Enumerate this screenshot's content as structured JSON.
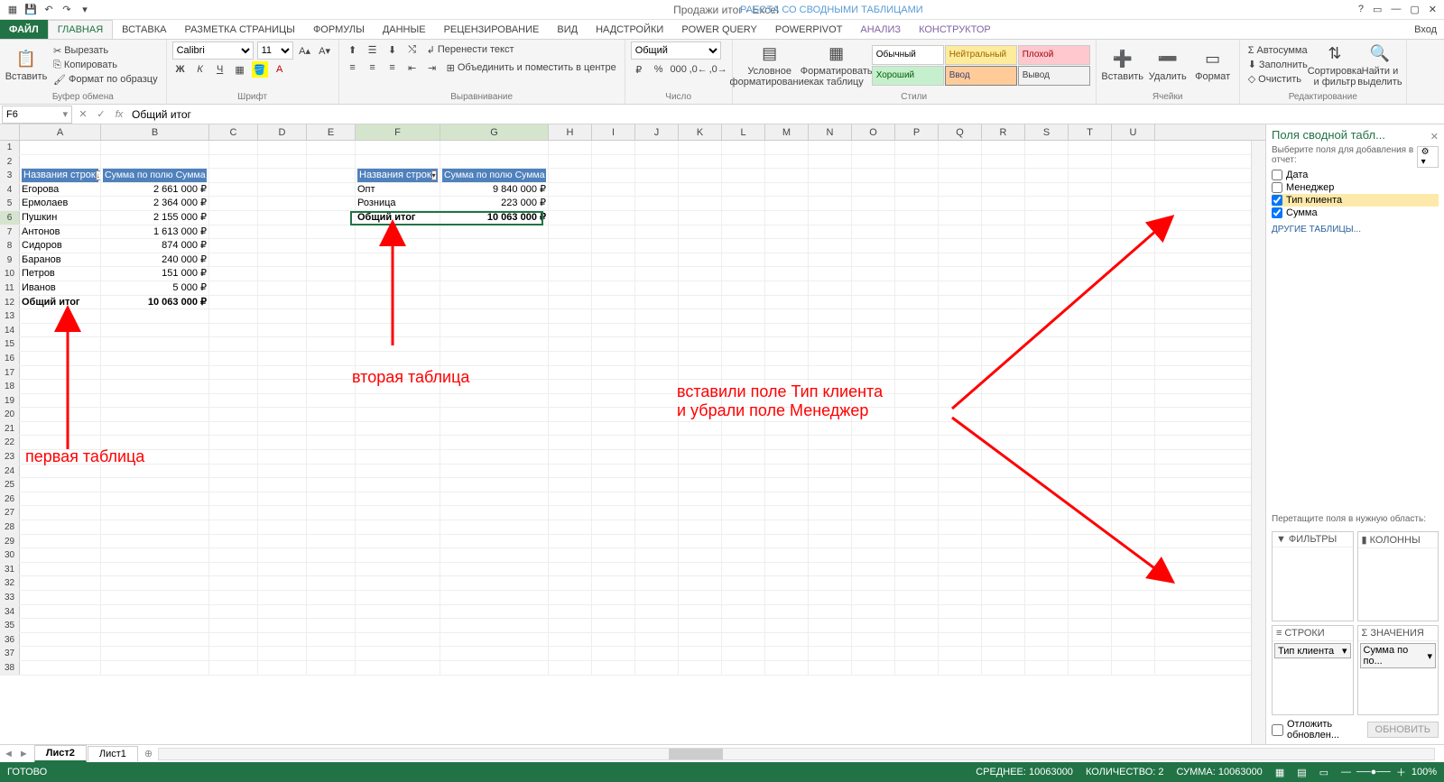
{
  "qat": {
    "title": "Продажи итог - Excel",
    "context": "РАБОТА СО СВОДНЫМИ ТАБЛИЦАМИ"
  },
  "tabs": {
    "file": "ФАЙЛ",
    "items": [
      "ГЛАВНАЯ",
      "ВСТАВКА",
      "РАЗМЕТКА СТРАНИЦЫ",
      "ФОРМУЛЫ",
      "ДАННЫЕ",
      "РЕЦЕНЗИРОВАНИЕ",
      "ВИД",
      "НАДСТРОЙКИ",
      "POWER QUERY",
      "POWERPIVOT",
      "АНАЛИЗ",
      "КОНСТРУКТОР"
    ],
    "login": "Вход"
  },
  "ribbon": {
    "clipboard": {
      "paste": "Вставить",
      "cut": "Вырезать",
      "copy": "Копировать",
      "fmt": "Формат по образцу",
      "label": "Буфер обмена"
    },
    "font": {
      "name": "Calibri",
      "size": "11",
      "label": "Шрифт"
    },
    "align": {
      "wrap": "Перенести текст",
      "merge": "Объединить и поместить в центре",
      "label": "Выравнивание"
    },
    "number": {
      "fmt": "Общий",
      "label": "Число"
    },
    "styles": {
      "cond": "Условное форматирование",
      "astable": "Форматировать как таблицу",
      "normal": "Обычный",
      "neutral": "Нейтральный",
      "bad": "Плохой",
      "good": "Хороший",
      "input": "Ввод",
      "output": "Вывод",
      "label": "Стили"
    },
    "cells": {
      "insert": "Вставить",
      "delete": "Удалить",
      "format": "Формат",
      "label": "Ячейки"
    },
    "edit": {
      "sum": "Автосумма",
      "fill": "Заполнить",
      "clear": "Очистить",
      "sort": "Сортировка и фильтр",
      "find": "Найти и выделить",
      "label": "Редактирование"
    }
  },
  "fbar": {
    "cell": "F6",
    "value": "Общий итог"
  },
  "cols": [
    "A",
    "B",
    "C",
    "D",
    "E",
    "F",
    "G",
    "H",
    "I",
    "J",
    "K",
    "L",
    "M",
    "N",
    "O",
    "P",
    "Q",
    "R",
    "S",
    "T",
    "U"
  ],
  "pivot1": {
    "h1": "Названия строк",
    "h2": "Сумма по полю Сумма",
    "rows": [
      [
        "Егорова",
        "2 661 000 ₽"
      ],
      [
        "Ермолаев",
        "2 364 000 ₽"
      ],
      [
        "Пушкин",
        "2 155 000 ₽"
      ],
      [
        "Антонов",
        "1 613 000 ₽"
      ],
      [
        "Сидоров",
        "874 000 ₽"
      ],
      [
        "Баранов",
        "240 000 ₽"
      ],
      [
        "Петров",
        "151 000 ₽"
      ],
      [
        "Иванов",
        "5 000 ₽"
      ]
    ],
    "total": [
      "Общий итог",
      "10 063 000 ₽"
    ]
  },
  "pivot2": {
    "h1": "Названия строк",
    "h2": "Сумма по полю Сумма",
    "rows": [
      [
        "Опт",
        "9 840 000 ₽"
      ],
      [
        "Розница",
        "223 000 ₽"
      ]
    ],
    "total": [
      "Общий итог",
      "10 063 000 ₽"
    ]
  },
  "annotations": {
    "t1": "первая таблица",
    "t2": "вторая таблица",
    "t3": "вставили поле Тип клиента\nи убрали поле Менеджер"
  },
  "pane": {
    "title": "Поля сводной табл...",
    "sub": "Выберите поля для добавления в отчет:",
    "fields": [
      {
        "n": "Дата",
        "c": false
      },
      {
        "n": "Менеджер",
        "c": false
      },
      {
        "n": "Тип клиента",
        "c": true
      },
      {
        "n": "Сумма",
        "c": true
      }
    ],
    "other": "ДРУГИЕ ТАБЛИЦЫ...",
    "drag": "Перетащите поля в нужную область:",
    "filters": "ФИЛЬТРЫ",
    "columns": "КОЛОННЫ",
    "rowsArea": "СТРОКИ",
    "values": "ЗНАЧЕНИЯ",
    "rowItem": "Тип клиента",
    "valItem": "Сумма по по...",
    "defer": "Отложить обновлен...",
    "update": "ОБНОВИТЬ"
  },
  "sheets": {
    "s1": "Лист2",
    "s2": "Лист1"
  },
  "status": {
    "ready": "ГОТОВО",
    "avg": "СРЕДНЕЕ: 10063000",
    "count": "КОЛИЧЕСТВО: 2",
    "sum": "СУММА: 10063000",
    "zoom": "100%"
  }
}
